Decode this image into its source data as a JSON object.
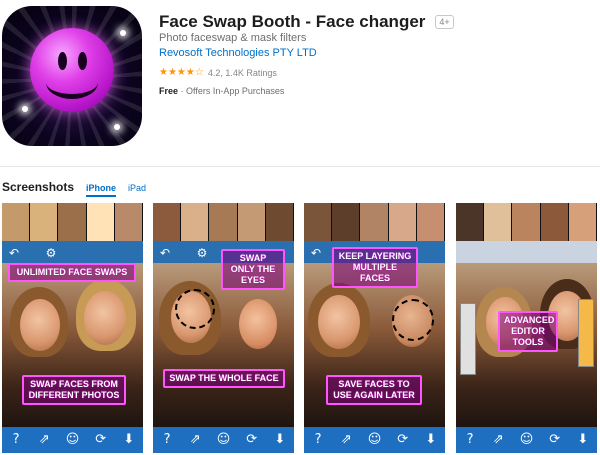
{
  "app": {
    "title": "Face Swap Booth - Face changer",
    "age_rating": "4+",
    "subtitle": "Photo faceswap & mask filters",
    "developer": "Revosoft Technologies PTY LTD",
    "stars": "★★★★☆",
    "rating_value": "4.2",
    "rating_count": "1.4K Ratings",
    "price": "Free",
    "iap": "Offers In-App Purchases"
  },
  "screenshots": {
    "title": "Screenshots",
    "tabs": [
      "iPhone",
      "iPad"
    ],
    "items": [
      {
        "labels": [
          "UNLIMITED FACE SWAPS",
          "SWAP FACES FROM DIFFERENT PHOTOS"
        ]
      },
      {
        "labels": [
          "SWAP ONLY THE EYES",
          "SWAP THE WHOLE FACE"
        ]
      },
      {
        "labels": [
          "KEEP LAYERING MULTIPLE FACES",
          "SAVE FACES TO USE AGAIN LATER"
        ]
      },
      {
        "labels": [
          "ADVANCED EDITOR TOOLS"
        ]
      }
    ],
    "bottom_icons": [
      "?",
      "⇗",
      "☺",
      "⟳",
      "⬇"
    ]
  },
  "colors": {
    "accent": "#0070c9",
    "label_border": "#ff55ff",
    "toolbar": "#1f6fc0"
  }
}
